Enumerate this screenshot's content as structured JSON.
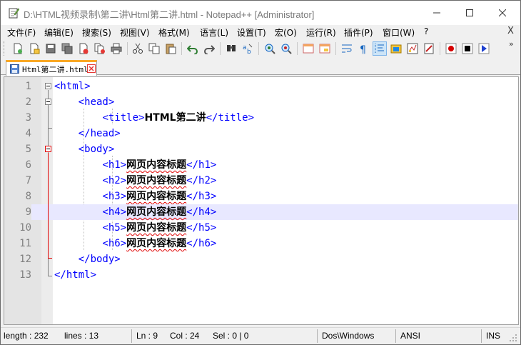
{
  "window": {
    "title": "D:\\HTML视频录制\\第二讲\\Html第二讲.html - Notepad++ [Administrator]"
  },
  "menu": {
    "items": [
      "文件(F)",
      "编辑(E)",
      "搜索(S)",
      "视图(V)",
      "格式(M)",
      "语言(L)",
      "设置(T)",
      "宏(O)",
      "运行(R)",
      "插件(P)",
      "窗口(W)",
      "?"
    ],
    "close_label": "X"
  },
  "toolbar": {
    "more_label": "»",
    "icons": [
      "new-file-icon",
      "open-file-icon",
      "save-icon",
      "save-all-icon",
      "close-icon",
      "close-all-icon",
      "print-icon",
      "cut-icon",
      "copy-icon",
      "paste-icon",
      "undo-icon",
      "redo-icon",
      "find-icon",
      "replace-icon",
      "zoom-in-icon",
      "zoom-out-icon",
      "sync-vertical-icon",
      "sync-horizontal-icon",
      "word-wrap-icon",
      "show-all-chars-icon",
      "indent-guide-icon",
      "user-language-icon",
      "function-list-icon",
      "folder-workspace-icon",
      "record-macro-icon",
      "stop-macro-icon",
      "play-macro-icon"
    ]
  },
  "tabs": [
    {
      "label": "Html第二讲.html",
      "active": true,
      "accent": "#f9a825"
    }
  ],
  "editor": {
    "current_line": 9,
    "lines": [
      {
        "num": "1",
        "indent": "",
        "open": "<html>",
        "text": "",
        "close": ""
      },
      {
        "num": "2",
        "indent": "    ",
        "open": "<head>",
        "text": "",
        "close": ""
      },
      {
        "num": "3",
        "indent": "        ",
        "open": "<title>",
        "text": "HTML第二讲",
        "close": "</title>"
      },
      {
        "num": "4",
        "indent": "    ",
        "open": "</head>",
        "text": "",
        "close": ""
      },
      {
        "num": "5",
        "indent": "    ",
        "open": "<body>",
        "text": "",
        "close": ""
      },
      {
        "num": "6",
        "indent": "        ",
        "open": "<h1>",
        "text": "网页内容标题",
        "close": "</h1>"
      },
      {
        "num": "7",
        "indent": "        ",
        "open": "<h2>",
        "text": "网页内容标题",
        "close": "</h2>"
      },
      {
        "num": "8",
        "indent": "        ",
        "open": "<h3>",
        "text": "网页内容标题",
        "close": "</h3>"
      },
      {
        "num": "9",
        "indent": "        ",
        "open": "<h4>",
        "text": "网页内容标题",
        "close": "</h4>"
      },
      {
        "num": "10",
        "indent": "        ",
        "open": "<h5>",
        "text": "网页内容标题",
        "close": "</h5>"
      },
      {
        "num": "11",
        "indent": "        ",
        "open": "<h6>",
        "text": "网页内容标题",
        "close": "</h6>"
      },
      {
        "num": "12",
        "indent": "    ",
        "open": "</body>",
        "text": "",
        "close": ""
      },
      {
        "num": "13",
        "indent": "",
        "open": "</html>",
        "text": "",
        "close": ""
      }
    ],
    "colors": {
      "tag": "#0000ff",
      "text": "#000000",
      "current_line": "#e8e8ff",
      "fold_marker": "#e00000"
    }
  },
  "status": {
    "length": "length : 232",
    "lines": "lines : 13",
    "ln": "Ln : 9",
    "col": "Col : 24",
    "sel": "Sel : 0 | 0",
    "eol": "Dos\\Windows",
    "encoding": "ANSI",
    "mode": "INS"
  }
}
